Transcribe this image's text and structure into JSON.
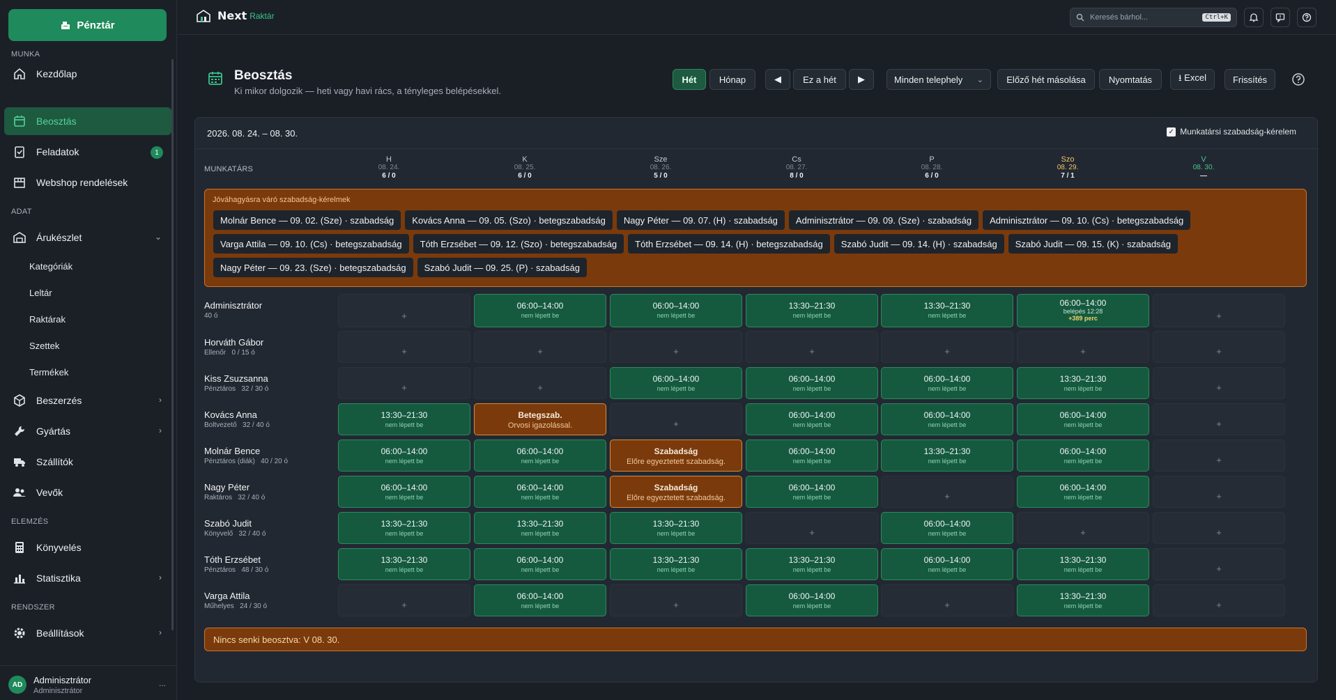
{
  "sidebar": {
    "pos_button": "Pénztár",
    "sections": {
      "work": "MUNKA",
      "data": "ADAT",
      "analysis": "ELEMZÉS",
      "system": "RENDSZER"
    },
    "items": {
      "home": "Kezdőlap",
      "schedule": "Beosztás",
      "tasks": "Feladatok",
      "tasks_badge": "1",
      "webshop": "Webshop rendelések",
      "inventory": "Árukészlet",
      "categories": "Kategóriák",
      "stocktake": "Leltár",
      "warehouses": "Raktárak",
      "sets": "Szettek",
      "products": "Termékek",
      "purchasing": "Beszerzés",
      "production": "Gyártás",
      "suppliers": "Szállítók",
      "customers": "Vevők",
      "accounting": "Könyvelés",
      "statistics": "Statisztika",
      "settings": "Beállítások"
    },
    "user": {
      "initials": "AD",
      "name": "Adminisztrátor",
      "role": "Adminisztrátor",
      "more": "..."
    }
  },
  "topbar": {
    "logo_name": "Next",
    "logo_sub": "Raktár",
    "search_placeholder": "Keresés bárhol...",
    "search_shortcut": "Ctrl+K"
  },
  "header": {
    "title": "Beosztás",
    "subtitle": "Ki mikor dolgozik — heti vagy havi rács, a tényleges belépésekkel.",
    "btn_week": "Hét",
    "btn_month": "Hónap",
    "btn_prev": "◀",
    "btn_this_week": "Ez a hét",
    "btn_next": "▶",
    "location": "Minden telephely",
    "btn_copy": "Előző hét másolása",
    "btn_print": "Nyomtatás",
    "btn_excel": "⭳ Excel",
    "btn_refresh": "Frissítés"
  },
  "board": {
    "week_range": "2026. 08. 24. – 08. 30.",
    "leave_request_label": "Munkatársi szabadság-kérelem",
    "leave_request_checked": true,
    "column_label": "MUNKATÁRS",
    "days": [
      {
        "d": "H",
        "date": "08. 24.",
        "count": "6 / 0"
      },
      {
        "d": "K",
        "date": "08. 25.",
        "count": "6 / 0"
      },
      {
        "d": "Sze",
        "date": "08. 26.",
        "count": "5 / 0"
      },
      {
        "d": "Cs",
        "date": "08. 27.",
        "count": "8 / 0"
      },
      {
        "d": "P",
        "date": "08. 28.",
        "count": "6 / 0"
      },
      {
        "d": "Szo",
        "date": "08. 29.",
        "count": "7 / 1"
      },
      {
        "d": "V",
        "date": "08. 30.",
        "count": "—"
      }
    ],
    "pending_title": "Jóváhagyásra váró szabadság-kérelmek",
    "pending": [
      "Molnár Bence — 09. 02. (Sze) · szabadság",
      "Kovács Anna — 09. 05. (Szo) · betegszabadság",
      "Nagy Péter — 09. 07. (H) · szabadság",
      "Adminisztrátor — 09. 09. (Sze) · szabadság",
      "Adminisztrátor — 09. 10. (Cs) · betegszabadság",
      "Varga Attila — 09. 10. (Cs) · betegszabadság",
      "Tóth Erzsébet — 09. 12. (Szo) · betegszabadság",
      "Tóth Erzsébet — 09. 14. (H) · betegszabadság",
      "Szabó Judit — 09. 14. (H) · szabadság",
      "Szabó Judit — 09. 15. (K) · szabadság",
      "Nagy Péter — 09. 23. (Sze) · betegszabadság",
      "Szabó Judit — 09. 25. (P) · szabadság"
    ],
    "employees": [
      {
        "name": "Adminisztrátor",
        "meta": "40 ó",
        "cells": [
          {
            "k": "empty"
          },
          {
            "k": "shift",
            "t": "06:00–14:00",
            "s": "nem lépett be"
          },
          {
            "k": "shift",
            "t": "06:00–14:00",
            "s": "nem lépett be"
          },
          {
            "k": "shift",
            "t": "13:30–21:30",
            "s": "nem lépett be"
          },
          {
            "k": "shift",
            "t": "13:30–21:30",
            "s": "nem lépett be"
          },
          {
            "k": "shift",
            "t": "06:00–14:00",
            "e": "belépés 12:28",
            "x": "+389 perc"
          },
          {
            "k": "empty"
          }
        ]
      },
      {
        "name": "Horváth Gábor",
        "meta": "Ellenőr   0 / 15 ó",
        "cells": [
          {
            "k": "empty"
          },
          {
            "k": "empty"
          },
          {
            "k": "empty"
          },
          {
            "k": "empty"
          },
          {
            "k": "empty"
          },
          {
            "k": "empty"
          },
          {
            "k": "empty"
          }
        ]
      },
      {
        "name": "Kiss Zsuzsanna",
        "meta": "Pénztáros   32 / 30 ó",
        "cells": [
          {
            "k": "empty"
          },
          {
            "k": "empty"
          },
          {
            "k": "shift",
            "t": "06:00–14:00",
            "s": "nem lépett be"
          },
          {
            "k": "shift",
            "t": "06:00–14:00",
            "s": "nem lépett be"
          },
          {
            "k": "shift",
            "t": "06:00–14:00",
            "s": "nem lépett be"
          },
          {
            "k": "shift",
            "t": "13:30–21:30",
            "s": "nem lépett be"
          },
          {
            "k": "empty"
          }
        ]
      },
      {
        "name": "Kovács Anna",
        "meta": "Boltvezető   32 / 40 ó",
        "cells": [
          {
            "k": "shift",
            "t": "13:30–21:30",
            "s": "nem lépett be"
          },
          {
            "k": "leave",
            "t": "Betegszab.",
            "s": "Orvosi igazolással."
          },
          {
            "k": "empty"
          },
          {
            "k": "shift",
            "t": "06:00–14:00",
            "s": "nem lépett be"
          },
          {
            "k": "shift",
            "t": "06:00–14:00",
            "s": "nem lépett be"
          },
          {
            "k": "shift",
            "t": "06:00–14:00",
            "s": "nem lépett be"
          },
          {
            "k": "empty"
          }
        ]
      },
      {
        "name": "Molnár Bence",
        "meta": "Pénztáros (diák)   40 / 20 ó",
        "cells": [
          {
            "k": "shift",
            "t": "06:00–14:00",
            "s": "nem lépett be"
          },
          {
            "k": "shift",
            "t": "06:00–14:00",
            "s": "nem lépett be"
          },
          {
            "k": "leave",
            "t": "Szabadság",
            "s": "Előre egyeztetett szabadság."
          },
          {
            "k": "shift",
            "t": "06:00–14:00",
            "s": "nem lépett be"
          },
          {
            "k": "shift",
            "t": "13:30–21:30",
            "s": "nem lépett be"
          },
          {
            "k": "shift",
            "t": "06:00–14:00",
            "s": "nem lépett be"
          },
          {
            "k": "empty"
          }
        ]
      },
      {
        "name": "Nagy Péter",
        "meta": "Raktáros   32 / 40 ó",
        "cells": [
          {
            "k": "shift",
            "t": "06:00–14:00",
            "s": "nem lépett be"
          },
          {
            "k": "shift",
            "t": "06:00–14:00",
            "s": "nem lépett be"
          },
          {
            "k": "leave",
            "t": "Szabadság",
            "s": "Előre egyeztetett szabadság."
          },
          {
            "k": "shift",
            "t": "06:00–14:00",
            "s": "nem lépett be"
          },
          {
            "k": "empty"
          },
          {
            "k": "shift",
            "t": "06:00–14:00",
            "s": "nem lépett be"
          },
          {
            "k": "empty"
          }
        ]
      },
      {
        "name": "Szabó Judit",
        "meta": "Könyvelő   32 / 40 ó",
        "cells": [
          {
            "k": "shift",
            "t": "13:30–21:30",
            "s": "nem lépett be"
          },
          {
            "k": "shift",
            "t": "13:30–21:30",
            "s": "nem lépett be"
          },
          {
            "k": "shift",
            "t": "13:30–21:30",
            "s": "nem lépett be"
          },
          {
            "k": "empty"
          },
          {
            "k": "shift",
            "t": "06:00–14:00",
            "s": "nem lépett be"
          },
          {
            "k": "empty"
          },
          {
            "k": "empty"
          }
        ]
      },
      {
        "name": "Tóth Erzsébet",
        "meta": "Pénztáros   48 / 30 ó",
        "cells": [
          {
            "k": "shift",
            "t": "13:30–21:30",
            "s": "nem lépett be"
          },
          {
            "k": "shift",
            "t": "06:00–14:00",
            "s": "nem lépett be"
          },
          {
            "k": "shift",
            "t": "13:30–21:30",
            "s": "nem lépett be"
          },
          {
            "k": "shift",
            "t": "13:30–21:30",
            "s": "nem lépett be"
          },
          {
            "k": "shift",
            "t": "06:00–14:00",
            "s": "nem lépett be"
          },
          {
            "k": "shift",
            "t": "13:30–21:30",
            "s": "nem lépett be"
          },
          {
            "k": "empty"
          }
        ]
      },
      {
        "name": "Varga Attila",
        "meta": "Műhelyes   24 / 30 ó",
        "cells": [
          {
            "k": "empty"
          },
          {
            "k": "shift",
            "t": "06:00–14:00",
            "s": "nem lépett be"
          },
          {
            "k": "empty"
          },
          {
            "k": "shift",
            "t": "06:00–14:00",
            "s": "nem lépett be"
          },
          {
            "k": "empty"
          },
          {
            "k": "shift",
            "t": "13:30–21:30",
            "s": "nem lépett be"
          },
          {
            "k": "empty"
          }
        ]
      }
    ],
    "empty_cell_symbol": "+",
    "nobody_scheduled": "Nincs senki beosztva: V 08. 30."
  },
  "colors": {
    "accent": "#1f8a5b",
    "shift_bg": "#155a3f",
    "warning_bg": "#7a3a0c",
    "warning_border": "#c7752a"
  }
}
